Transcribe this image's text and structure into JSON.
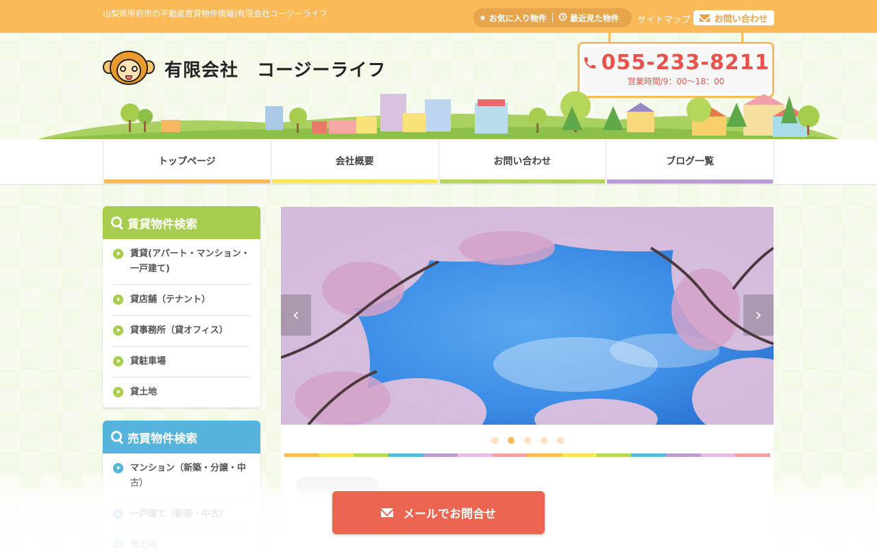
{
  "topbar": {
    "tagline": "山梨県甲府市の不動産賃貸物件情報|有限会社コージーライフ",
    "favorites": "お気に入り物件",
    "recent": "最近見た物件",
    "sitemap": "サイトマップ",
    "contact": "お問い合わせ"
  },
  "header": {
    "company": "有限会社　コージーライフ",
    "phone": "055-233-8211",
    "hours": "営業時間/9：00〜18：00"
  },
  "nav": [
    {
      "label": "トップページ",
      "color": "#fcb957"
    },
    {
      "label": "会社概要",
      "color": "#fbe45a"
    },
    {
      "label": "お問い合わせ",
      "color": "#b4d65a"
    },
    {
      "label": "ブログ一覧",
      "color": "#b89bd6"
    }
  ],
  "rental": {
    "title": "賃貸物件検索",
    "color": "#a6cd4e",
    "items": [
      "賃貸(アパート・マンション・一戸建て)",
      "貸店舗（テナント）",
      "貸事務所（貸オフィス）",
      "貸駐車場",
      "貸土地"
    ]
  },
  "sale": {
    "title": "売買物件検索",
    "color": "#55b3dc",
    "items": [
      "マンション（新築・分譲・中古）",
      "一戸建て（新築・中古）",
      "売土地"
    ]
  },
  "slider": {
    "dots": 5,
    "active": 1
  },
  "stripe_colors": [
    "#fcb957",
    "#fbe45a",
    "#b4d65a",
    "#5bb7dd",
    "#b89bd6",
    "#f1b7e4",
    "#f2a0a0",
    "#fcb957",
    "#fbe45a",
    "#b4d65a",
    "#5bb7dd",
    "#b89bd6",
    "#f1b7e4",
    "#f2a0a0"
  ],
  "mail_button": "メールでお問合せ"
}
